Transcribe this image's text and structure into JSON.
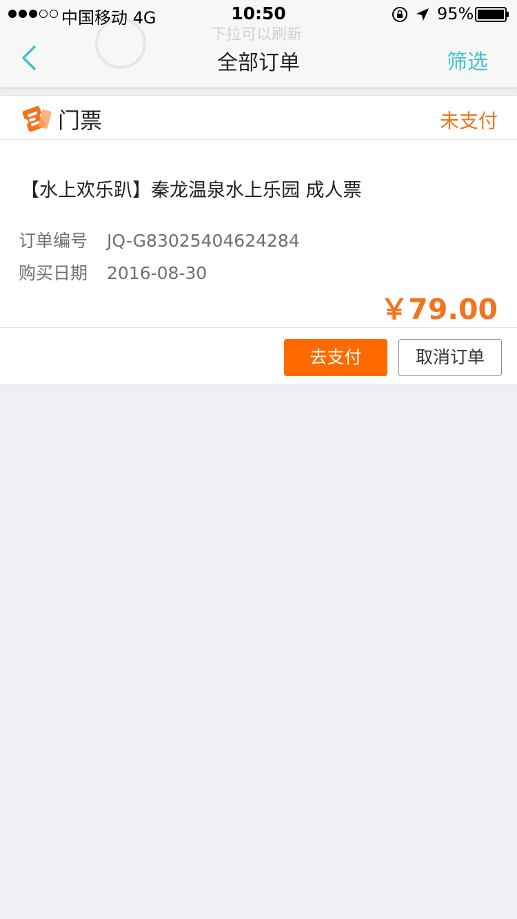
{
  "status_bar": {
    "carrier": "中国移动  4G",
    "time": "10:50",
    "battery": "95%",
    "signal_bars_filled": 3,
    "signal_bars_total": 5
  },
  "refresh": {
    "hint": "下拉可以刷新"
  },
  "nav": {
    "title": "全部订单",
    "filter_label": "筛选",
    "back_icon": "chevron-left-icon"
  },
  "order": {
    "type": "门票",
    "type_icon": "ticket-icon",
    "status": "未支付",
    "product": "【水上欢乐趴】秦龙温泉水上乐园 成人票",
    "order_no_label": "订单编号",
    "order_no": "JQ-G83025404624284",
    "date_label": "购买日期",
    "date": "2016-08-30",
    "price": "￥79.00",
    "pay_label": "去支付",
    "cancel_label": "取消订单"
  },
  "colors": {
    "accent_orange": "#ff6a00",
    "status_orange": "#f5731c",
    "nav_accent": "#3fc1d6",
    "background": "#efeff4"
  }
}
